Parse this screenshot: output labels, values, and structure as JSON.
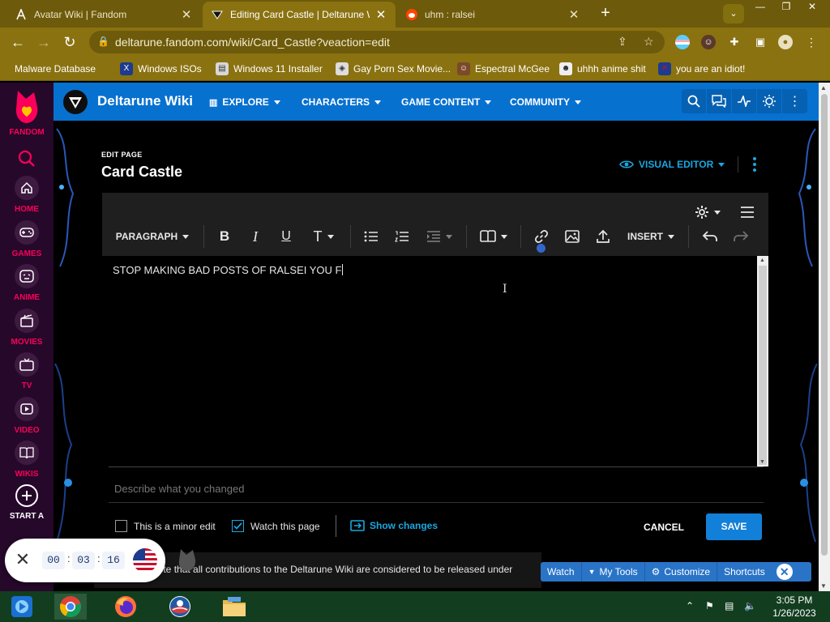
{
  "browser": {
    "tabs": [
      {
        "title": "Avatar Wiki | Fandom",
        "active": false,
        "icon": "fandom-avatar-favicon"
      },
      {
        "title": "Editing Card Castle | Deltarune W",
        "active": true,
        "icon": "deltarune-favicon"
      },
      {
        "title": "uhm : ralsei",
        "active": false,
        "icon": "reddit-favicon"
      }
    ],
    "url": "deltarune.fandom.com/wiki/Card_Castle?veaction=edit",
    "bookmarks": [
      {
        "label": "Malware Database",
        "icon": "folder-icon"
      },
      {
        "label": "Windows ISOs",
        "icon": "x-icon"
      },
      {
        "label": "Windows 11 Installer",
        "icon": "installer-icon"
      },
      {
        "label": "Gay Porn Sex Movie...",
        "icon": "site-icon"
      },
      {
        "label": "Espectral McGee",
        "icon": "profile-icon"
      },
      {
        "label": "uhhh anime shit",
        "icon": "anime-icon"
      },
      {
        "label": "you are an idiot!",
        "icon": "flag-uk-icon"
      }
    ]
  },
  "fandom_nav": {
    "brand": "FANDOM",
    "items": [
      {
        "label": "HOME",
        "icon": "home-icon"
      },
      {
        "label": "GAMES",
        "icon": "gamepad-icon"
      },
      {
        "label": "ANIME",
        "icon": "anime-face-icon"
      },
      {
        "label": "MOVIES",
        "icon": "clapper-icon"
      },
      {
        "label": "TV",
        "icon": "tv-icon"
      },
      {
        "label": "VIDEO",
        "icon": "play-icon"
      },
      {
        "label": "WIKIS",
        "icon": "book-icon"
      },
      {
        "label": "START A",
        "icon": "plus-circle-icon"
      }
    ]
  },
  "community": {
    "wiki_name": "Deltarune Wiki",
    "nav": [
      "EXPLORE",
      "CHARACTERS",
      "GAME CONTENT",
      "COMMUNITY"
    ]
  },
  "editor": {
    "kicker": "EDIT PAGE",
    "page_title": "Card Castle",
    "mode_label": "VISUAL EDITOR",
    "toolbar": {
      "paragraph_label": "PARAGRAPH",
      "insert_label": "INSERT"
    },
    "content": "STOP MAKING BAD POSTS OF RALSEI YOU F",
    "summary_placeholder": "Describe what you changed",
    "minor_edit_label": "This is a minor edit",
    "minor_edit_checked": false,
    "watch_label": "Watch this page",
    "watch_checked": true,
    "show_changes_label": "Show changes",
    "cancel_label": "CANCEL",
    "save_label": "SAVE",
    "notice": "note that all contributions to the Deltarune Wiki are considered to be released under"
  },
  "timer": {
    "hours": "00",
    "minutes": "03",
    "seconds": "16"
  },
  "bottom_toolbar": [
    "Watch",
    "My Tools",
    "Customize",
    "Shortcuts"
  ],
  "taskbar": {
    "time": "3:05 PM",
    "date": "1/26/2023",
    "apps": [
      "media-player-icon",
      "chrome-icon",
      "firefox-icon",
      "obama-app-icon",
      "file-explorer-icon"
    ]
  },
  "colors": {
    "chrome_frame": "#8a7210",
    "fandom_nav": "#26082a",
    "fandom_pink": "#fa005a",
    "community_bar": "#0771d0",
    "accent": "#1aa7e0",
    "save_button": "#1280d8"
  }
}
